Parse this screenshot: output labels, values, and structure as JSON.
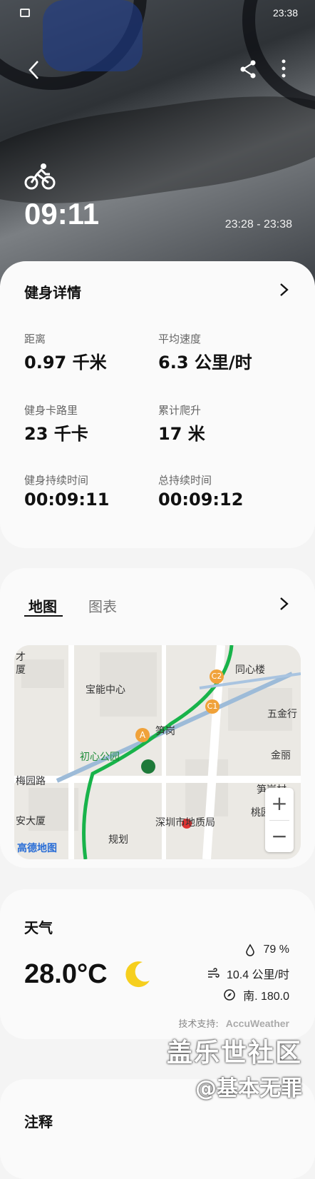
{
  "status_bar": {
    "time": "23:38"
  },
  "hero": {
    "activity_icon": "bicycle-icon",
    "duration": "09:11",
    "time_range": "23:28 - 23:38"
  },
  "fitness": {
    "title": "健身详情",
    "stats": [
      {
        "label": "距离",
        "value": "0.97 千米"
      },
      {
        "label": "平均速度",
        "value": "6.3 公里/时"
      },
      {
        "label": "健身卡路里",
        "value": "23 千卡"
      },
      {
        "label": "累计爬升",
        "value": "17 米"
      },
      {
        "label": "健身持续时间",
        "value": "00:09:11"
      },
      {
        "label": "总持续时间",
        "value": "00:09:12"
      }
    ]
  },
  "map_card": {
    "tabs": [
      "地图",
      "图表"
    ],
    "active_tab": "地图",
    "labels": {
      "l1": "才",
      "l2": "厦",
      "l3": "宝能中心",
      "l4": "同心楼",
      "l5": "五金行",
      "l6": "笋岗",
      "l7": "初心公园",
      "l8": "金丽",
      "l9": "梅园路",
      "l10": "笋岗村",
      "l11": "安大厦",
      "l12": "桃园",
      "l13": "深圳市地质局",
      "l14": "规划",
      "l15": "高德地图",
      "marker_a": "A",
      "marker_c1": "C1",
      "marker_c2": "C2"
    },
    "zoom_in": "+",
    "zoom_out": "−"
  },
  "weather": {
    "title": "天气",
    "temperature": "28.0°C",
    "humidity": "79 %",
    "wind_speed": "10.4 公里/时",
    "wind_dir": "南. 180.0",
    "credit_label": "技术支持:",
    "credit_brand": "AccuWeather"
  },
  "notes": {
    "title": "注释"
  },
  "watermark": {
    "line1": "盖乐世社区",
    "line2": "@基本无罪"
  }
}
